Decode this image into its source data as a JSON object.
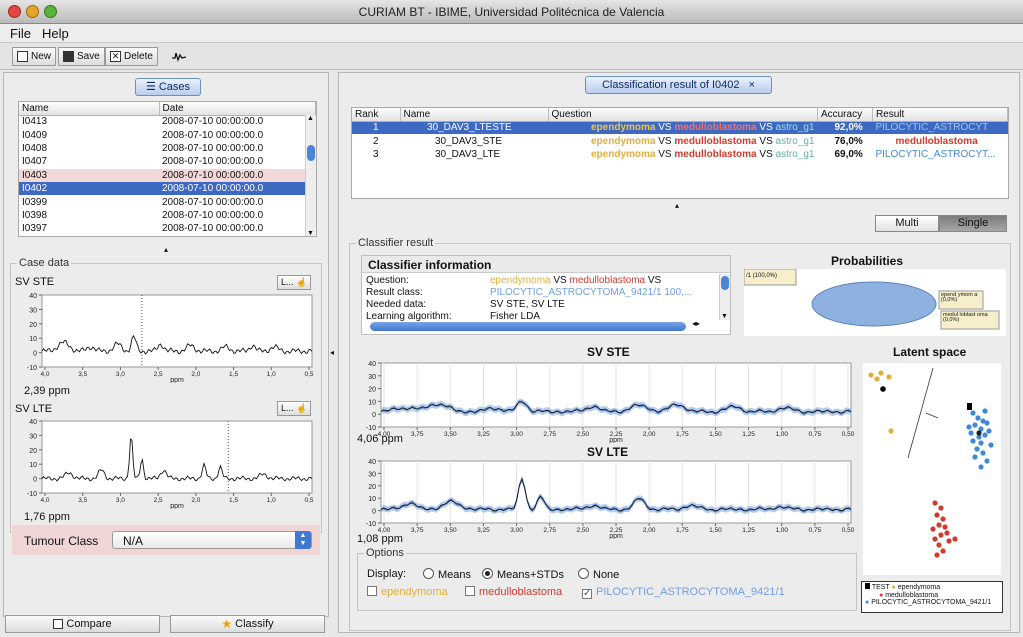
{
  "window": {
    "title": "CURIAM BT - IBIME, Universidad Politécnica de Valencia"
  },
  "menu": {
    "file": "File",
    "help": "Help"
  },
  "toolbar": {
    "new": "New",
    "save": "Save",
    "delete": "Delete"
  },
  "cases": {
    "button": "Cases",
    "columns": [
      "Name",
      "Date"
    ],
    "rows": [
      [
        "I0413",
        "2008-07-10 00:00:00.0"
      ],
      [
        "I0409",
        "2008-07-10 00:00:00.0"
      ],
      [
        "I0408",
        "2008-07-10 00:00:00.0"
      ],
      [
        "I0407",
        "2008-07-10 00:00:00.0"
      ],
      [
        "I0403",
        "2008-07-10 00:00:00.0"
      ],
      [
        "I0402",
        "2008-07-10 00:00:00.0"
      ],
      [
        "I0399",
        "2008-07-10 00:00:00.0"
      ],
      [
        "I0398",
        "2008-07-10 00:00:00.0"
      ],
      [
        "I0397",
        "2008-07-10 00:00:00.0"
      ]
    ]
  },
  "case_data": {
    "title": "Case data",
    "ste": {
      "label": "SV STE",
      "button": "L...",
      "ppm": "2,39 ppm",
      "xunit": "ppm",
      "yticks": [
        "40",
        "30",
        "20",
        "10",
        "0",
        "-10"
      ],
      "xticks": [
        "4,0",
        "3,5",
        "3,0",
        "2,5",
        "2,0",
        "1,5",
        "1,0",
        "0,5"
      ]
    },
    "lte": {
      "label": "SV LTE",
      "button": "L...",
      "ppm": "1,76 ppm",
      "xunit": "ppm",
      "yticks": [
        "40",
        "30",
        "20",
        "10",
        "0",
        "-10"
      ],
      "xticks": [
        "4,0",
        "3,5",
        "3,0",
        "2,5",
        "2,0",
        "1,5",
        "1,0",
        "0,5"
      ]
    },
    "tumour_label": "Tumour Class",
    "tumour_value": "N/A"
  },
  "bottom_buttons": {
    "compare": "Compare",
    "classify": "Classify"
  },
  "result_tab": {
    "title": "Classification result of I0402",
    "close": "×"
  },
  "results": {
    "columns": [
      "Rank",
      "Name",
      "Question",
      "Accuracy",
      "Result"
    ],
    "rows": [
      {
        "rank": "1",
        "name": "30_DAV3_LTESTE",
        "q1": "ependymoma",
        "vs": "VS",
        "q2": "medulloblastoma",
        "q3": "astro_g1",
        "acc": "92,0%",
        "result": "PILOCYTIC_ASTROCYT"
      },
      {
        "rank": "2",
        "name": "30_DAV3_STE",
        "q1": "ependymoma",
        "vs": "VS",
        "q2": "medulloblastoma",
        "q3": "astro_g1",
        "acc": "76,0%",
        "result": "medulloblastoma"
      },
      {
        "rank": "3",
        "name": "30_DAV3_LTE",
        "q1": "ependymoma",
        "vs": "VS",
        "q2": "medulloblastoma",
        "q3": "astro_g1",
        "acc": "69,0%",
        "result": "PILOCYTIC_ASTROCYT..."
      }
    ]
  },
  "view_toggle": {
    "multi": "Multi",
    "single": "Single"
  },
  "classifier_result": {
    "group_title": "Classifier result",
    "info_title": "Classifier information",
    "info_rows": [
      {
        "key": "Question:",
        "v1": "ependymoma",
        "vs": "VS",
        "v2": "medulloblastoma",
        "vs2": "VS"
      },
      {
        "key": "Result class:",
        "v1": "PILOCYTIC_ASTROCYTOMA_9421/1 100,..."
      },
      {
        "key": "Needed data:",
        "v1": "SV STE, SV LTE"
      },
      {
        "key": "Learning algorithm:",
        "v1": "Fisher LDA"
      }
    ],
    "probabilities": {
      "title": "Probabilities",
      "label_a": "/1 (100,0%)",
      "label_b": "epend ymom a (0,0%)",
      "label_c": "medul loblast oma (0,0%)"
    },
    "ste_plot": {
      "title": "SV STE",
      "ppm": "4,06 ppm",
      "xunit": "ppm",
      "yticks": [
        "40",
        "30",
        "20",
        "10",
        "0",
        "-10"
      ],
      "xticks": [
        "4,00",
        "3,75",
        "3,50",
        "3,25",
        "3,00",
        "2,75",
        "2,50",
        "2,25",
        "2,00",
        "1,75",
        "1,50",
        "1,25",
        "1,00",
        "0,75",
        "0,50"
      ]
    },
    "lte_plot": {
      "title": "SV LTE",
      "ppm": "1,08 ppm",
      "xunit": "ppm",
      "yticks": [
        "40",
        "30",
        "20",
        "10",
        "0",
        "-10"
      ],
      "xticks": [
        "4,00",
        "3,75",
        "3,50",
        "3,25",
        "3,00",
        "2,75",
        "2,50",
        "2,25",
        "2,00",
        "1,75",
        "1,50",
        "1,25",
        "1,00",
        "0,75",
        "0,50"
      ]
    },
    "latent": {
      "title": "Latent space",
      "legend": [
        "TEST",
        "ependymoma",
        "medulloblastoma",
        "PILOCYTIC_ASTROCYTOMA_9421/1"
      ]
    }
  },
  "options": {
    "title": "Options",
    "display_label": "Display:",
    "radios": [
      "Means",
      "Means+STDs",
      "None"
    ],
    "selected": "Means+STDs",
    "checks": [
      "ependymoma",
      "medulloblastoma",
      "PILOCYTIC_ASTROCYTOMA_9421/1"
    ]
  },
  "colors": {
    "ependymoma": "#e0b03a",
    "medulloblastoma": "#d23a2e",
    "pilocytic": "#3f8ad8",
    "astro": "#5fb3a6",
    "selection": "#3d69c2"
  }
}
